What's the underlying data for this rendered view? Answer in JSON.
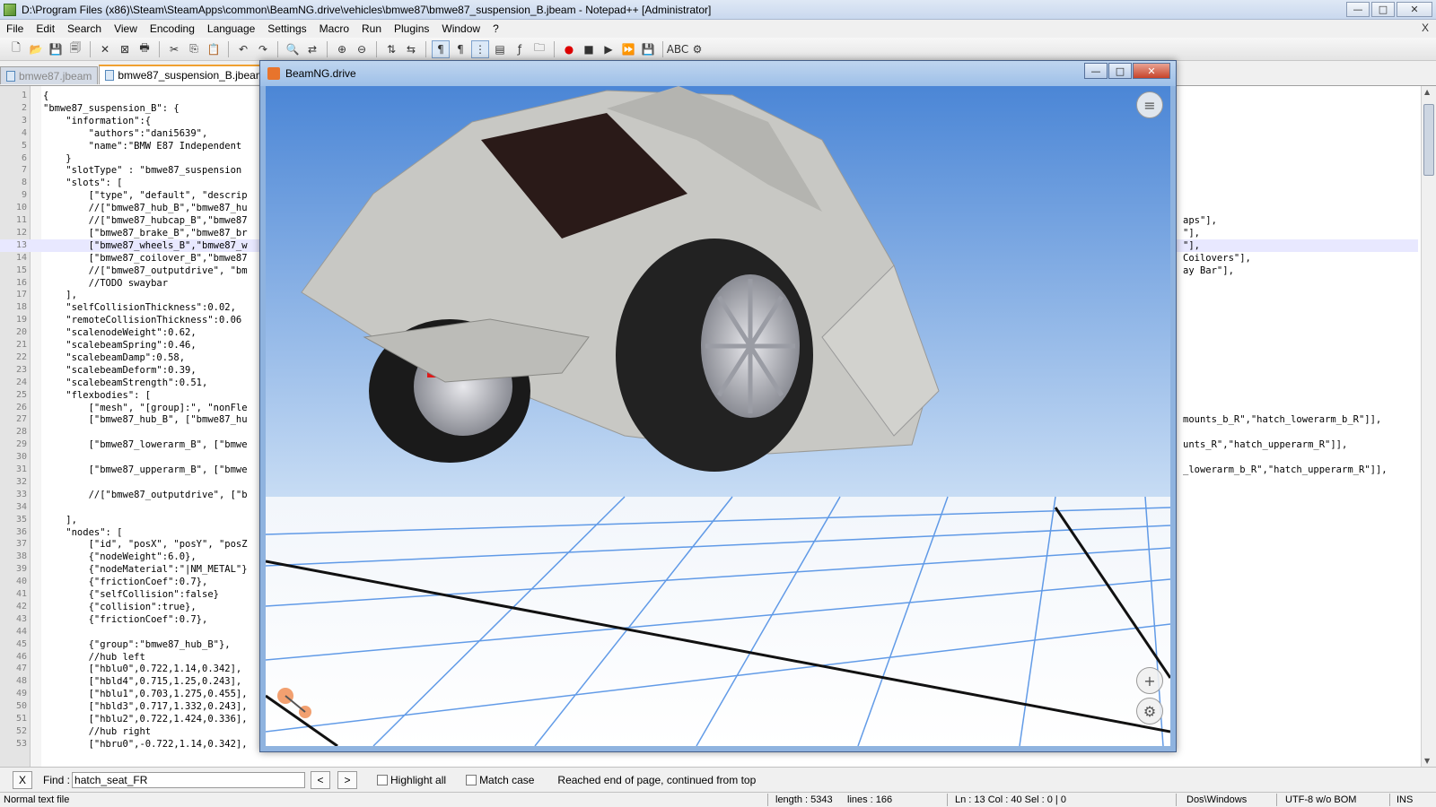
{
  "window": {
    "title": "D:\\Program Files (x86)\\Steam\\SteamApps\\common\\BeamNG.drive\\vehicles\\bmwe87\\bmwe87_suspension_B.jbeam - Notepad++ [Administrator]",
    "minimize": "—",
    "maximize": "□",
    "close": "✕"
  },
  "menu": {
    "items": [
      "File",
      "Edit",
      "Search",
      "View",
      "Encoding",
      "Language",
      "Settings",
      "Macro",
      "Run",
      "Plugins",
      "Window",
      "?"
    ],
    "close_doc": "X"
  },
  "toolbar": {
    "icons": [
      "new-file-icon",
      "open-file-icon",
      "save-icon",
      "save-all-icon",
      "close-icon",
      "close-all-icon",
      "print-icon",
      "cut-icon",
      "copy-icon",
      "paste-icon",
      "undo-icon",
      "redo-icon",
      "find-icon",
      "replace-icon",
      "zoom-in-icon",
      "zoom-out-icon",
      "sync-v-icon",
      "sync-h-icon",
      "word-wrap-icon",
      "all-chars-icon",
      "indent-guide-icon",
      "doc-map-icon",
      "function-list-icon",
      "folder-workspace-icon",
      "record-macro-icon",
      "stop-macro-icon",
      "play-macro-icon",
      "run-macro-multiple-icon",
      "save-macro-icon",
      "spellcheck-icon",
      "plugin-icon"
    ]
  },
  "tabs": [
    {
      "label": "bmwe87.jbeam",
      "active": false
    },
    {
      "label": "bmwe87_suspension_B.jbeam",
      "active": true
    }
  ],
  "editor": {
    "current_line": 13,
    "lines": [
      "{",
      "\"bmwe87_suspension_B\": {",
      "    \"information\":{",
      "        \"authors\":\"dani5639\",",
      "        \"name\":\"BMW E87 Independent",
      "    }",
      "    \"slotType\" : \"bmwe87_suspension",
      "    \"slots\": [",
      "        [\"type\", \"default\", \"descrip",
      "        //[\"bmwe87_hub_B\",\"bmwe87_hu",
      "        //[\"bmwe87_hubcap_B\",\"bmwe87",
      "        [\"bmwe87_brake_B\",\"bmwe87_br",
      "        [\"bmwe87_wheels_B\",\"bmwe87_w",
      "        [\"bmwe87_coilover_B\",\"bmwe87",
      "        //[\"bmwe87_outputdrive\", \"bm",
      "        //TODO swaybar",
      "    ],",
      "    \"selfCollisionThickness\":0.02,",
      "    \"remoteCollisionThickness\":0.06",
      "    \"scalenodeWeight\":0.62,",
      "    \"scalebeamSpring\":0.46,",
      "    \"scalebeamDamp\":0.58,",
      "    \"scalebeamDeform\":0.39,",
      "    \"scalebeamStrength\":0.51,",
      "    \"flexbodies\": [",
      "        [\"mesh\", \"[group]:\", \"nonFle",
      "        [\"bmwe87_hub_B\", [\"bmwe87_hu",
      "",
      "        [\"bmwe87_lowerarm_B\", [\"bmwe",
      "",
      "        [\"bmwe87_upperarm_B\", [\"bmwe",
      "",
      "        //[\"bmwe87_outputdrive\", [\"b",
      "",
      "    ],",
      "    \"nodes\": [",
      "        [\"id\", \"posX\", \"posY\", \"posZ",
      "        {\"nodeWeight\":6.0},",
      "        {\"nodeMaterial\":\"|NM_METAL\"}",
      "        {\"frictionCoef\":0.7},",
      "        {\"selfCollision\":false}",
      "        {\"collision\":true},",
      "        {\"frictionCoef\":0.7},",
      "",
      "        {\"group\":\"bmwe87_hub_B\"},",
      "        //hub left",
      "        [\"hblu0\",0.722,1.14,0.342],",
      "        [\"hbld4\",0.715,1.25,0.243],",
      "        [\"hblu1\",0.703,1.275,0.455],",
      "        [\"hbld3\",0.717,1.332,0.243],",
      "        [\"hblu2\",0.722,1.424,0.336],",
      "        //hub right",
      "        [\"hbru0\",-0.722,1.14,0.342],"
    ],
    "right_fragments": [
      {
        "line": 11,
        "text": "aps\"],"
      },
      {
        "line": 12,
        "text": "\"],"
      },
      {
        "line": 13,
        "text": "\"],"
      },
      {
        "line": 14,
        "text": "Coilovers\"],"
      },
      {
        "line": 15,
        "text": "ay Bar\"],"
      },
      {
        "line": 27,
        "text": "mounts_b_R\",\"hatch_lowerarm_b_R\"]],"
      },
      {
        "line": 29,
        "text": "unts_R\",\"hatch_upperarm_R\"]],"
      },
      {
        "line": 31,
        "text": "_lowerarm_b_R\",\"hatch_upperarm_R\"]],"
      }
    ]
  },
  "beamng": {
    "title": "BeamNG.drive",
    "menu_icon": "menu-icon",
    "zoom_icon": "plus-icon",
    "settings_icon": "gear-icon"
  },
  "findbar": {
    "close": "X",
    "label": "Find :",
    "value": "hatch_seat_FR",
    "prev": "<",
    "next": ">",
    "highlight_all": "Highlight all",
    "match_case": "Match case",
    "message": "Reached end of page, continued from top"
  },
  "statusbar": {
    "filetype": "Normal text file",
    "length": "length : 5343",
    "lines": "lines : 166",
    "position": "Ln : 13    Col : 40    Sel : 0 | 0",
    "eol": "Dos\\Windows",
    "encoding": "UTF-8 w/o BOM",
    "mode": "INS"
  },
  "colors": {
    "sky_top": "#4b86d6",
    "sky_bottom": "#c7dcf4",
    "grid_blue": "#2f7be0",
    "car_body": "#c8c8c4",
    "brake_red": "#e01818"
  }
}
